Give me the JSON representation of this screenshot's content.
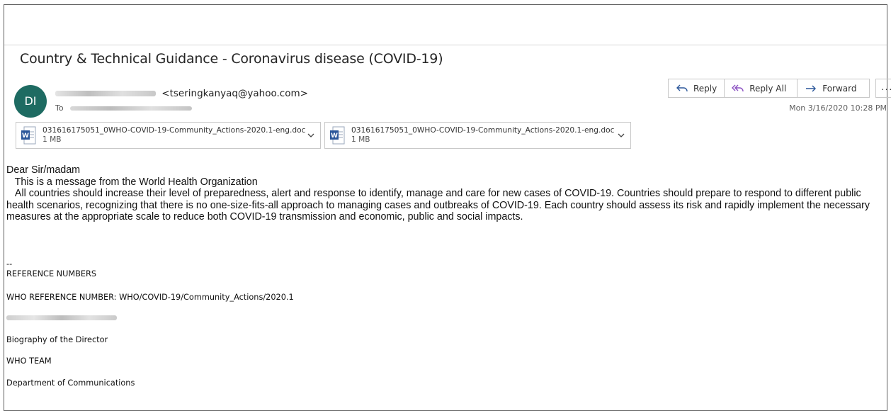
{
  "email": {
    "subject": "Country & Technical Guidance - Coronavirus disease (COVID-19)",
    "avatar_initials": "DI",
    "from_address": "<tseringkanyaq@yahoo.com>",
    "to_label": "To",
    "date": "Mon 3/16/2020 10:28 PM"
  },
  "actions": {
    "reply": "Reply",
    "reply_all": "Reply All",
    "forward": "Forward",
    "more": "···"
  },
  "attachments": [
    {
      "name": "031616175051_0WHO-COVID-19-Community_Actions-2020.1-eng.doc",
      "size": "1 MB"
    },
    {
      "name": "031616175051_0WHO-COVID-19-Community_Actions-2020.1-eng.doc",
      "size": "1 MB"
    }
  ],
  "body": {
    "greeting": "Dear Sir/madam",
    "line1": "   This is a message from the World Health Organization",
    "paragraph": "   All countries should increase their level of preparedness, alert and response to identify, manage and care for new cases of COVID-19. Countries should prepare to respond to different public health scenarios, recognizing that there is no one-size-fits-all approach to managing cases and outbreaks of COVID-19. Each country should assess its risk and rapidly implement the necessary measures at the appropriate scale to reduce both COVID-19 transmission and economic, public and social impacts."
  },
  "signature": {
    "separator": "--",
    "ref_heading": "REFERENCE NUMBERS",
    "who_ref": "WHO REFERENCE NUMBER: WHO/COVID-19/Community_Actions/2020.1",
    "bio": "Biography of the Director",
    "team": "WHO TEAM",
    "dept": "Department of Communications"
  },
  "colors": {
    "avatar_bg": "#1e6b62",
    "accent": "#2b579a",
    "reply_all_icon": "#8a4fc2"
  }
}
